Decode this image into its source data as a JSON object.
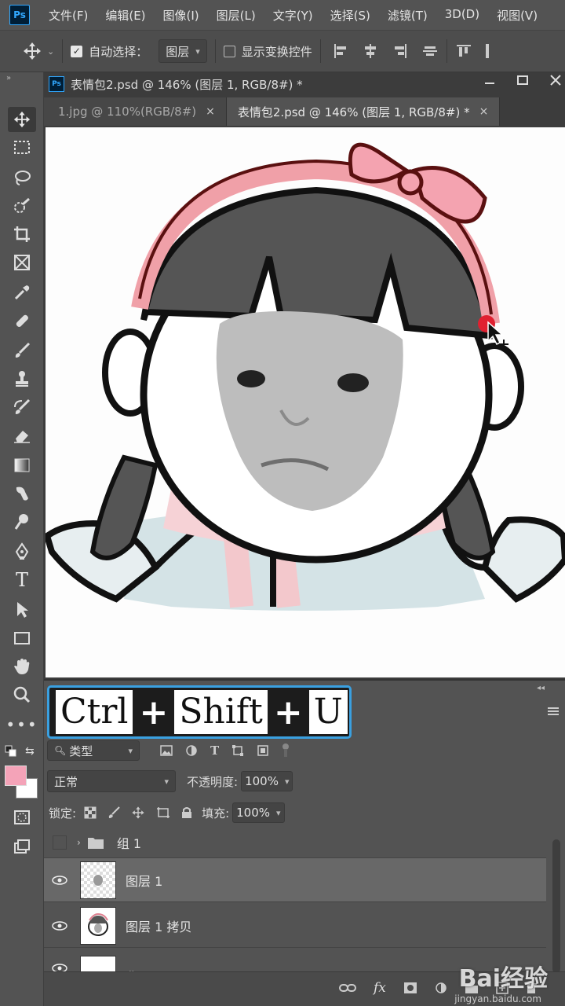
{
  "app": {
    "logo": "Ps"
  },
  "menu": [
    "文件(F)",
    "编辑(E)",
    "图像(I)",
    "图层(L)",
    "文字(Y)",
    "选择(S)",
    "滤镜(T)",
    "3D(D)",
    "视图(V)"
  ],
  "options": {
    "auto_select_label": "自动选择：",
    "auto_select_value": "图层",
    "show_transform_label": "显示变换控件"
  },
  "document": {
    "title": "表情包2.psd @ 146% (图层 1, RGB/8#) *",
    "tabs": [
      {
        "label": "1.jpg @ 110%(RGB/8#)",
        "close": "×"
      },
      {
        "label": "表情包2.psd @ 146% (图层 1, RGB/8#) *",
        "close": "×"
      }
    ]
  },
  "shortcut": {
    "k1": "Ctrl",
    "plus": "+",
    "k2": "Shift",
    "k3": "U"
  },
  "layers_panel": {
    "filter_label": "类型",
    "blend_mode": "正常",
    "opacity_label": "不透明度:",
    "opacity_value": "100%",
    "lock_label": "锁定:",
    "fill_label": "填充:",
    "fill_value": "100%",
    "layers": [
      {
        "name": "组 1",
        "type": "group"
      },
      {
        "name": "图层 1",
        "type": "layer"
      },
      {
        "name": "图层 1 拷贝",
        "type": "layer"
      },
      {
        "name": "背景",
        "type": "layer"
      }
    ]
  },
  "colors": {
    "foreground": "#f4a3b8",
    "background": "#ffffff",
    "accent": "#3aa0e0"
  },
  "watermark": {
    "main": "Bai经验",
    "sub": "jingyan.baidu.com"
  }
}
